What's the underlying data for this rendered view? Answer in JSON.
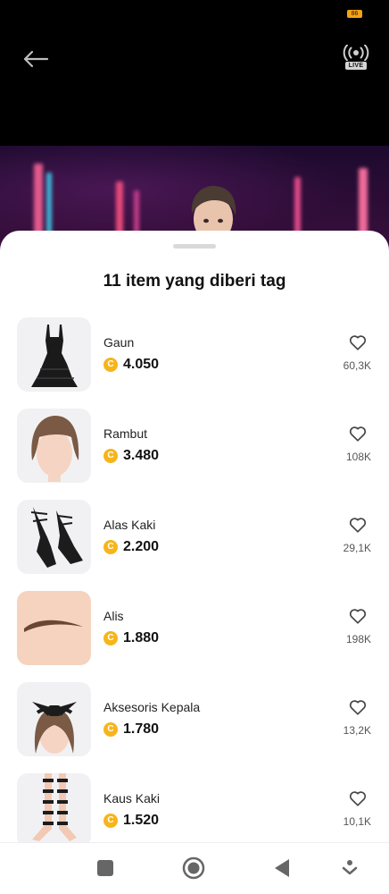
{
  "status_bar": {
    "battery": "86"
  },
  "header": {
    "back_icon": "arrow-left-icon",
    "live_label": "LIVE"
  },
  "sheet": {
    "title": "11 item yang diberi tag",
    "items": [
      {
        "name": "Gaun",
        "price": "4.050",
        "likes": "60,3K",
        "thumb": "dress"
      },
      {
        "name": "Rambut",
        "price": "3.480",
        "likes": "108K",
        "thumb": "hair"
      },
      {
        "name": "Alas Kaki",
        "price": "2.200",
        "likes": "29,1K",
        "thumb": "shoes"
      },
      {
        "name": "Alis",
        "price": "1.880",
        "likes": "198K",
        "thumb": "eyebrows"
      },
      {
        "name": "Aksesoris Kepala",
        "price": "1.780",
        "likes": "13,2K",
        "thumb": "head-accessory"
      },
      {
        "name": "Kaus Kaki",
        "price": "1.520",
        "likes": "10,1K",
        "thumb": "socks"
      }
    ],
    "coin_symbol": "C"
  },
  "colors": {
    "coin": "#f6b51b",
    "battery": "#f2a318"
  },
  "nav": [
    "square-icon",
    "home-circle-icon",
    "back-triangle-icon",
    "menu-down-icon"
  ]
}
